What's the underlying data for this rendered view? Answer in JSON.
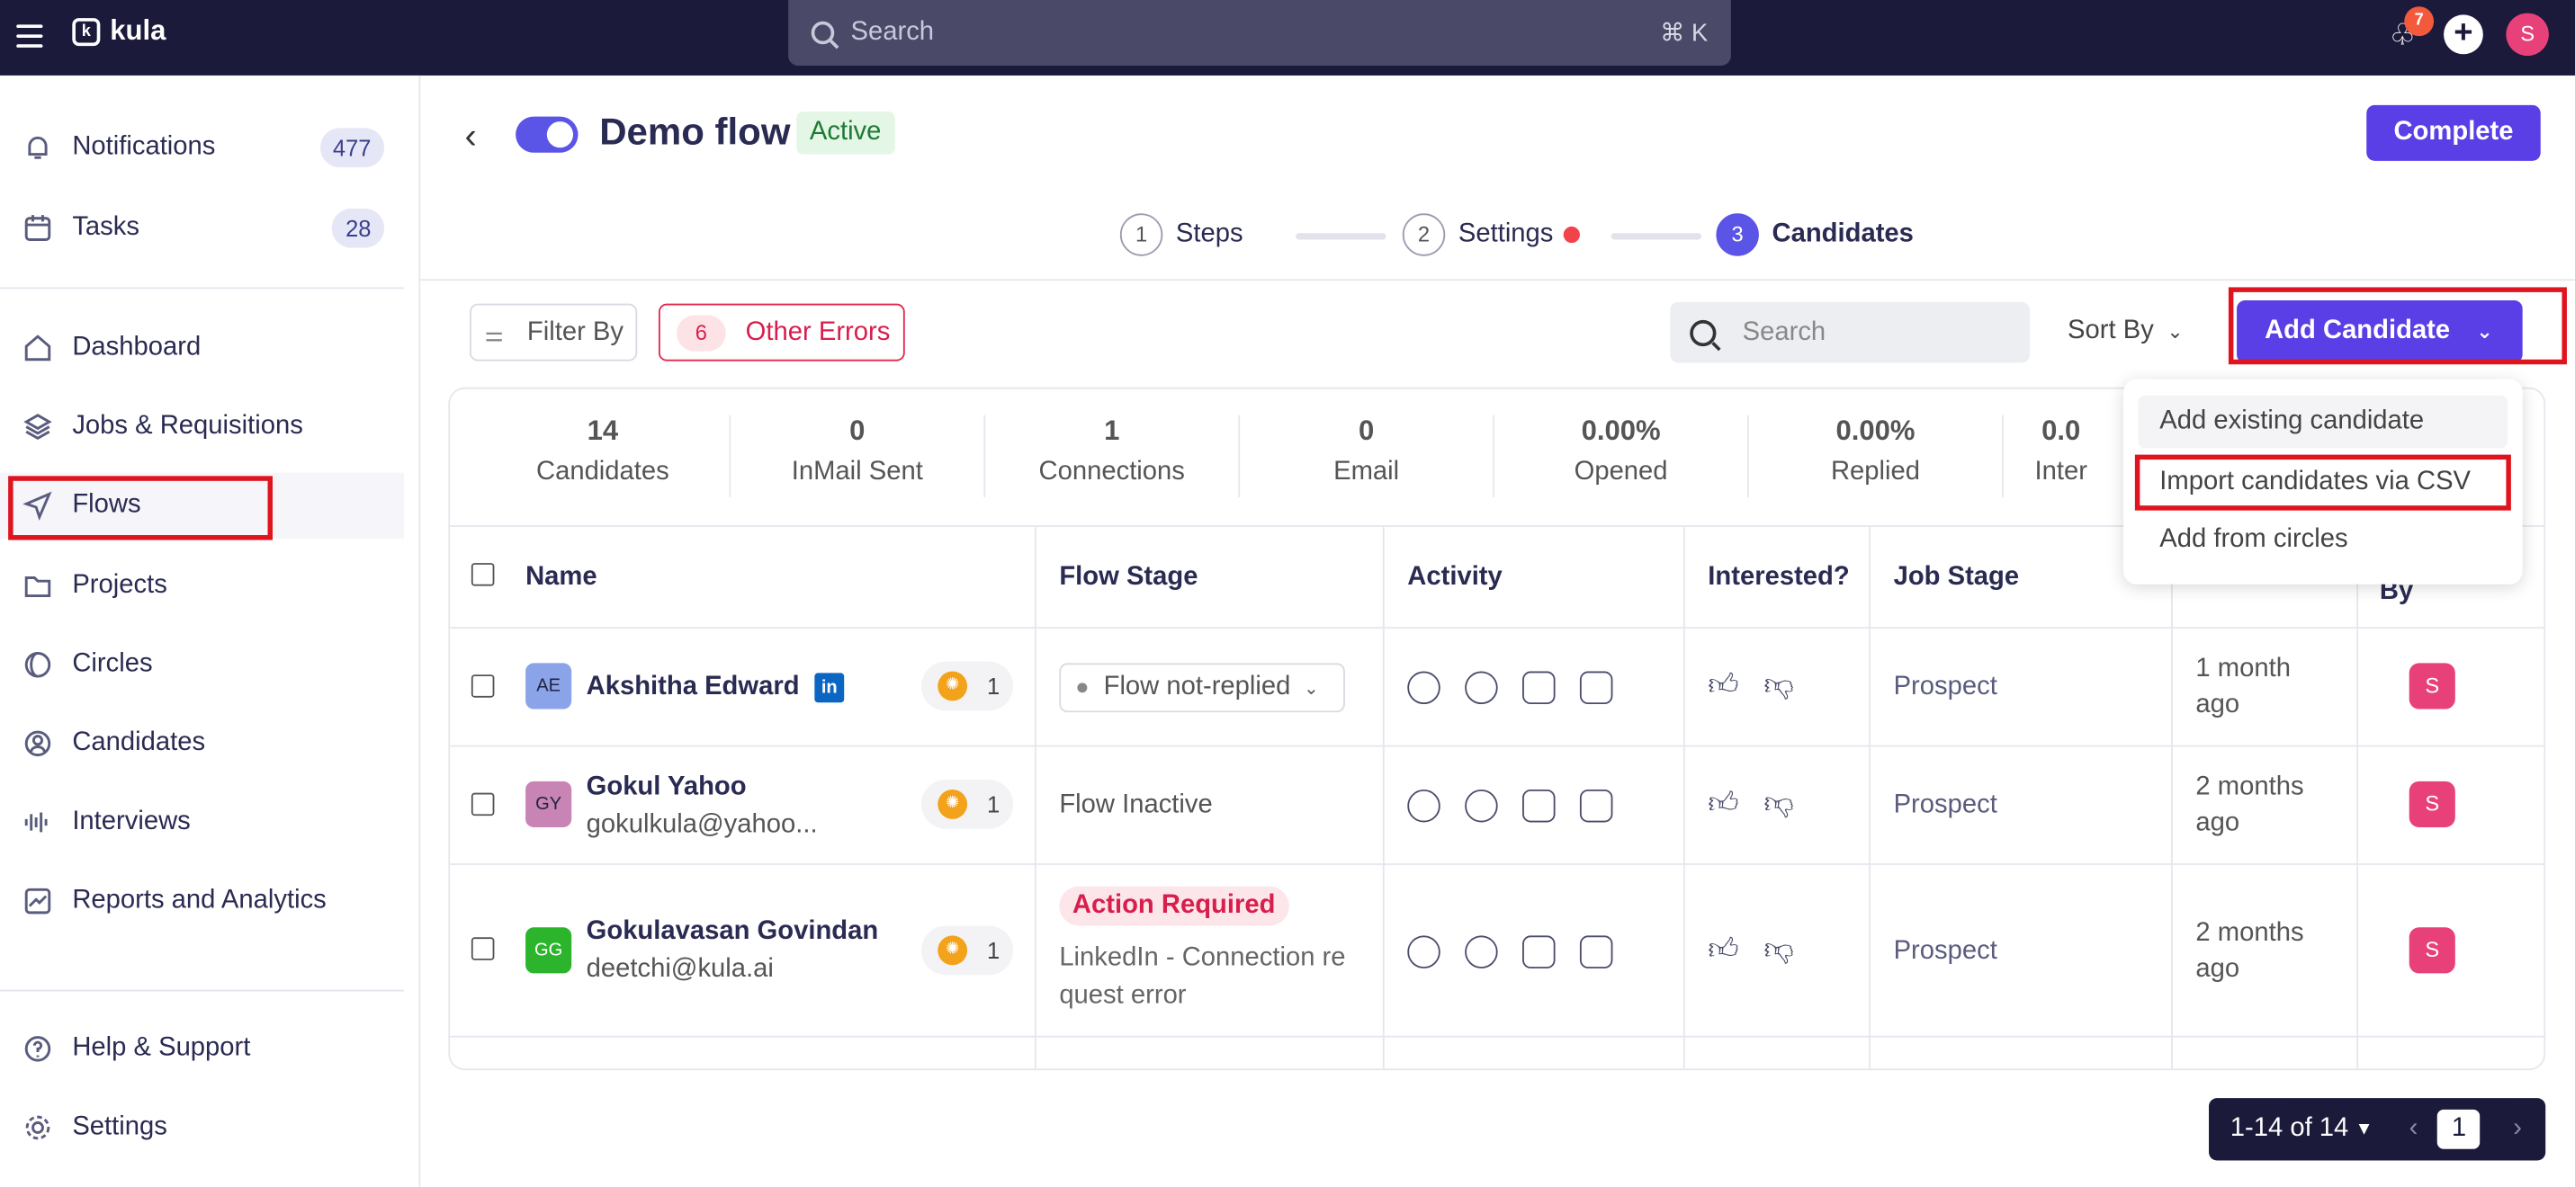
{
  "topbar": {
    "app_name": "kula",
    "search_placeholder": "Search",
    "search_shortcut": "⌘ K",
    "notification_count": "7",
    "user_initial": "S"
  },
  "sidebar": {
    "items": [
      {
        "label": "Notifications",
        "badge": "477",
        "icon": "bell-icon"
      },
      {
        "label": "Tasks",
        "badge": "28",
        "icon": "calendar-icon"
      },
      {
        "label": "Dashboard",
        "icon": "home-icon"
      },
      {
        "label": "Jobs & Requisitions",
        "icon": "layers-icon"
      },
      {
        "label": "Flows",
        "icon": "send-icon"
      },
      {
        "label": "Projects",
        "icon": "folder-icon"
      },
      {
        "label": "Circles",
        "icon": "circles-icon"
      },
      {
        "label": "Candidates",
        "icon": "user-circle-icon"
      },
      {
        "label": "Interviews",
        "icon": "audio-bars-icon"
      },
      {
        "label": "Reports and Analytics",
        "icon": "chart-icon"
      },
      {
        "label": "Help & Support",
        "icon": "help-icon"
      },
      {
        "label": "Settings",
        "icon": "gear-icon"
      }
    ]
  },
  "header": {
    "title": "Demo flow",
    "status": "Active",
    "complete_label": "Complete"
  },
  "stepper": {
    "steps": [
      {
        "num": "1",
        "label": "Steps"
      },
      {
        "num": "2",
        "label": "Settings"
      },
      {
        "num": "3",
        "label": "Candidates"
      }
    ]
  },
  "toolbar": {
    "filter_label": "Filter By",
    "errors_count": "6",
    "errors_label": "Other Errors",
    "search_placeholder": "Search",
    "sort_label": "Sort By",
    "add_candidate_label": "Add Candidate"
  },
  "dropdown": {
    "items": [
      "Add existing candidate",
      "Import candidates via CSV",
      "Add from circles"
    ]
  },
  "stats": [
    {
      "value": "14",
      "label": "Candidates"
    },
    {
      "value": "0",
      "label": "InMail Sent"
    },
    {
      "value": "1",
      "label": "Connections"
    },
    {
      "value": "0",
      "label": "Email"
    },
    {
      "value": "0.00%",
      "label": "Opened"
    },
    {
      "value": "0.00%",
      "label": "Replied"
    },
    {
      "value": "0.0",
      "label": "Inter"
    }
  ],
  "table": {
    "headers": {
      "name": "Name",
      "flow_stage": "Flow Stage",
      "activity": "Activity",
      "interested": "Interested?",
      "job_stage": "Job Stage",
      "by": "By"
    },
    "rows": [
      {
        "initials": "AE",
        "name": "Akshitha Edward",
        "sub": "",
        "badge": "1",
        "stage": "Flow not-replied",
        "job_stage": "Prospect",
        "time_1": "1 month",
        "time_2": "ago",
        "owner": "S"
      },
      {
        "initials": "GY",
        "name": "Gokul Yahoo",
        "sub": "gokulkula@yahoo...",
        "badge": "1",
        "stage": "Flow Inactive",
        "job_stage": "Prospect",
        "time_1": "2 months",
        "time_2": "ago",
        "owner": "S"
      },
      {
        "initials": "GG",
        "name": "Gokulavasan Govindan",
        "sub": "deetchi@kula.ai",
        "badge": "1",
        "stage": "Action Required",
        "stage_detail": "LinkedIn - Connection re quest error",
        "job_stage": "Prospect",
        "time_1": "2 months",
        "time_2": "ago",
        "owner": "S"
      }
    ]
  },
  "pagination": {
    "range": "1-14 of 14",
    "page": "1"
  },
  "colors": {
    "primary": "#5a3fe6",
    "topbar": "#1b1a3a",
    "error": "#d81e4c",
    "active_badge_bg": "#e4f6e6"
  }
}
